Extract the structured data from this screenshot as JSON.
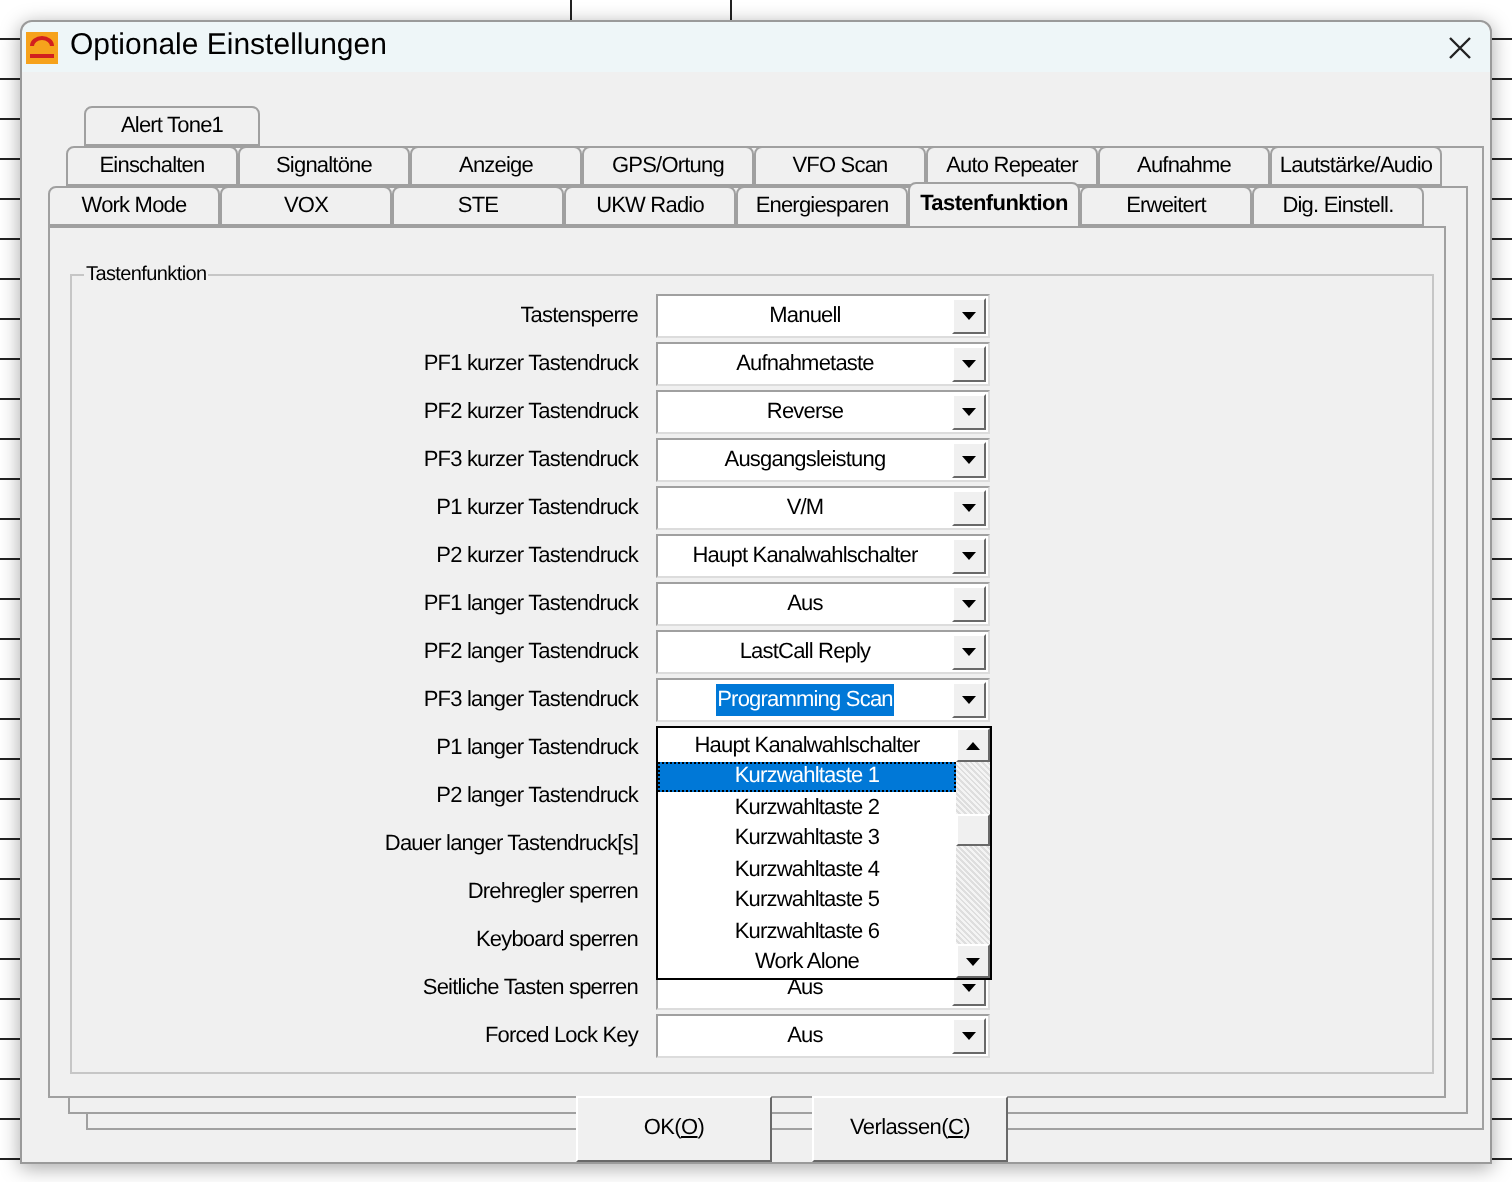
{
  "window": {
    "title": "Optionale Einstellungen"
  },
  "tab_rows": [
    [
      {
        "label": "Alert Tone1",
        "selected": false
      }
    ],
    [
      {
        "label": "Einschalten",
        "selected": false
      },
      {
        "label": "Signaltöne",
        "selected": false
      },
      {
        "label": "Anzeige",
        "selected": false
      },
      {
        "label": "GPS/Ortung",
        "selected": false
      },
      {
        "label": "VFO Scan",
        "selected": false
      },
      {
        "label": "Auto Repeater",
        "selected": false
      },
      {
        "label": "Aufnahme",
        "selected": false
      },
      {
        "label": "Lautstärke/Audio",
        "selected": false
      }
    ],
    [
      {
        "label": "Work Mode",
        "selected": false
      },
      {
        "label": "VOX",
        "selected": false
      },
      {
        "label": "STE",
        "selected": false
      },
      {
        "label": "UKW Radio",
        "selected": false
      },
      {
        "label": "Energiesparen",
        "selected": false
      },
      {
        "label": "Tastenfunktion",
        "selected": true
      },
      {
        "label": "Erweitert",
        "selected": false
      },
      {
        "label": "Dig. Einstell.",
        "selected": false
      }
    ]
  ],
  "group": {
    "title": "Tastenfunktion",
    "rows": [
      {
        "label": "Tastensperre",
        "value": "Manuell",
        "highlighted": false
      },
      {
        "label": "PF1 kurzer Tastendruck",
        "value": "Aufnahmetaste",
        "highlighted": false
      },
      {
        "label": "PF2 kurzer Tastendruck",
        "value": "Reverse",
        "highlighted": false
      },
      {
        "label": "PF3 kurzer Tastendruck",
        "value": "Ausgangsleistung",
        "highlighted": false
      },
      {
        "label": "P1 kurzer Tastendruck",
        "value": "V/M",
        "highlighted": false
      },
      {
        "label": "P2 kurzer Tastendruck",
        "value": "Haupt Kanalwahlschalter",
        "highlighted": false
      },
      {
        "label": "PF1 langer Tastendruck",
        "value": "Aus",
        "highlighted": false
      },
      {
        "label": "PF2 langer Tastendruck",
        "value": "LastCall Reply",
        "highlighted": false
      },
      {
        "label": "PF3 langer Tastendruck",
        "value": "Programming Scan",
        "highlighted": true
      },
      {
        "label": "P1 langer Tastendruck",
        "open": true,
        "options": [
          {
            "label": "Haupt Kanalwahlschalter",
            "selected": false
          },
          {
            "label": "Kurzwahltaste 1",
            "selected": true
          },
          {
            "label": "Kurzwahltaste 2",
            "selected": false
          },
          {
            "label": "Kurzwahltaste 3",
            "selected": false
          },
          {
            "label": "Kurzwahltaste 4",
            "selected": false
          },
          {
            "label": "Kurzwahltaste 5",
            "selected": false
          },
          {
            "label": "Kurzwahltaste 6",
            "selected": false
          },
          {
            "label": "Work Alone",
            "selected": false
          }
        ]
      },
      {
        "label": "P2 langer Tastendruck"
      },
      {
        "label": "Dauer langer Tastendruck[s]"
      },
      {
        "label": "Drehregler sperren"
      },
      {
        "label": "Keyboard sperren"
      },
      {
        "label": "Seitliche Tasten sperren",
        "value": "Aus",
        "highlighted": false
      },
      {
        "label": "Forced Lock Key",
        "value": "Aus",
        "highlighted": false
      }
    ]
  },
  "buttons": [
    {
      "before": "OK(",
      "mnemonic": "O",
      "after": ")"
    },
    {
      "before": "Verlassen(",
      "mnemonic": "C",
      "after": ")"
    }
  ]
}
